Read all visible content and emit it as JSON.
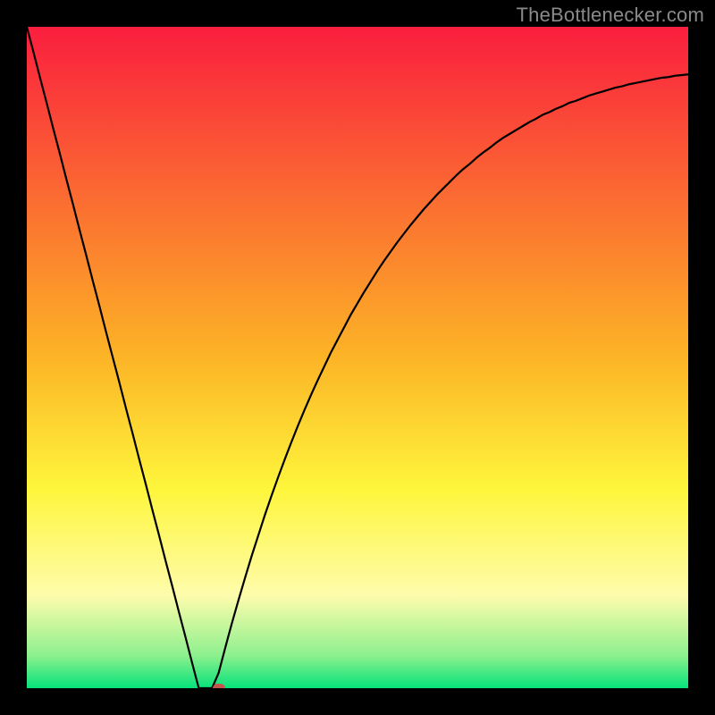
{
  "watermark": "TheBottlenecker.com",
  "colors": {
    "top": "#fa1e3e",
    "mid_upper": "#fcb426",
    "mid": "#fef63c",
    "mid_lower": "#fefcac",
    "near_bottom": "#8ef08e",
    "bottom": "#06e27a",
    "curve": "#000000",
    "frame": "#000000",
    "marker": "#c4554d"
  },
  "chart_data": {
    "type": "line",
    "title": "",
    "xlabel": "",
    "ylabel": "",
    "xlim": [
      0,
      100
    ],
    "ylim": [
      0,
      100
    ],
    "x": [
      0,
      1,
      2,
      3,
      4,
      5,
      6,
      7,
      8,
      9,
      10,
      11,
      12,
      13,
      14,
      15,
      16,
      17,
      18,
      19,
      20,
      21,
      22,
      23,
      24,
      25,
      26,
      27,
      28,
      29,
      30,
      31,
      32,
      33,
      34,
      35,
      36,
      37,
      38,
      39,
      40,
      41,
      42,
      43,
      44,
      45,
      46,
      47,
      48,
      49,
      50,
      51,
      52,
      53,
      54,
      55,
      56,
      57,
      58,
      59,
      60,
      61,
      62,
      63,
      64,
      65,
      66,
      67,
      68,
      69,
      70,
      71,
      72,
      73,
      74,
      75,
      76,
      77,
      78,
      79,
      80,
      81,
      82,
      83,
      84,
      85,
      86,
      87,
      88,
      89,
      90,
      91,
      92,
      93,
      94,
      95,
      96,
      97,
      98,
      99,
      100
    ],
    "values": [
      100,
      96.2,
      92.3,
      88.5,
      84.6,
      80.8,
      76.9,
      73.1,
      69.2,
      65.4,
      61.5,
      57.7,
      53.8,
      50,
      46.2,
      42.3,
      38.5,
      34.6,
      30.8,
      26.9,
      23.1,
      19.2,
      15.4,
      11.5,
      7.7,
      3.8,
      0,
      0,
      0,
      2.3,
      6.1,
      9.8,
      13.3,
      16.7,
      20,
      23.1,
      26.2,
      29.1,
      31.9,
      34.6,
      37.2,
      39.7,
      42.1,
      44.4,
      46.6,
      48.7,
      50.8,
      52.7,
      54.6,
      56.5,
      58.2,
      59.9,
      61.5,
      63.1,
      64.6,
      66,
      67.4,
      68.7,
      70,
      71.2,
      72.4,
      73.5,
      74.6,
      75.6,
      76.6,
      77.6,
      78.5,
      79.3,
      80.2,
      81,
      81.7,
      82.5,
      83.2,
      83.8,
      84.4,
      85,
      85.6,
      86.1,
      86.7,
      87.1,
      87.6,
      88,
      88.5,
      88.8,
      89.2,
      89.6,
      89.9,
      90.2,
      90.5,
      90.8,
      91,
      91.3,
      91.5,
      91.7,
      91.9,
      92.1,
      92.3,
      92.4,
      92.6,
      92.7,
      92.8
    ],
    "marker": {
      "x": 29,
      "y": 0
    },
    "gradient_stops": [
      {
        "pos": 0,
        "color_key": "top"
      },
      {
        "pos": 50,
        "color_key": "mid_upper"
      },
      {
        "pos": 70,
        "color_key": "mid"
      },
      {
        "pos": 86,
        "color_key": "mid_lower"
      },
      {
        "pos": 95,
        "color_key": "near_bottom"
      },
      {
        "pos": 100,
        "color_key": "bottom"
      }
    ]
  }
}
